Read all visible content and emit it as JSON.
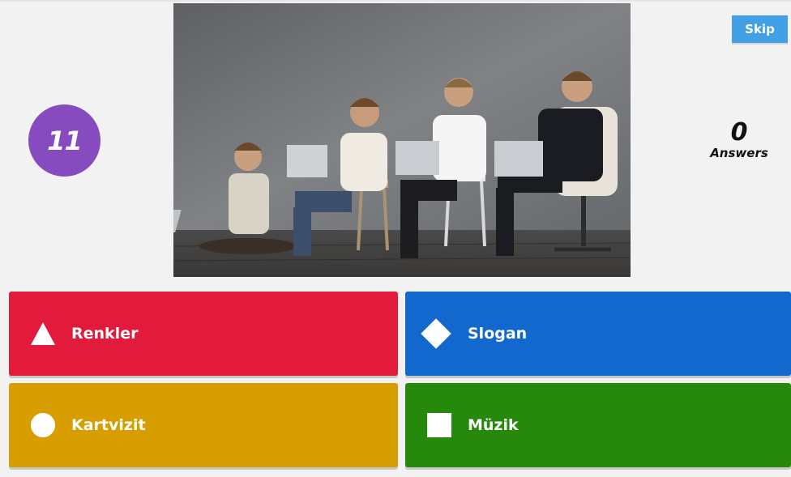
{
  "timer": {
    "value": "11"
  },
  "skip_button": {
    "label": "Skip"
  },
  "answers_counter": {
    "count": "0",
    "label": "Answers"
  },
  "question_image": {
    "description_icon": "image-icon"
  },
  "options": [
    {
      "label": "Renkler",
      "shape": "triangle-icon",
      "color": "#e21b3c"
    },
    {
      "label": "Slogan",
      "shape": "diamond-icon",
      "color": "#1368ce"
    },
    {
      "label": "Kartvizit",
      "shape": "circle-icon",
      "color": "#d89e00"
    },
    {
      "label": "Müzik",
      "shape": "square-icon",
      "color": "#26890c"
    }
  ]
}
